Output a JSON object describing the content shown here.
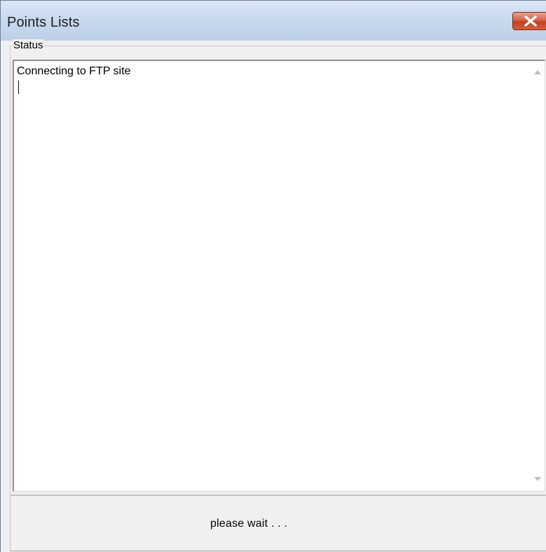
{
  "window": {
    "title": "Points Lists"
  },
  "status_group": {
    "label": "Status",
    "text": "Connecting to FTP site"
  },
  "wait_panel": {
    "text": "please wait . . ."
  },
  "icons": {
    "close": "close-icon",
    "scroll_up": "scroll-up-arrow-icon",
    "scroll_down": "scroll-down-arrow-icon"
  },
  "colors": {
    "close_button": "#c2401f",
    "titlebar": "#c9daee",
    "panel": "#f0f0f0"
  }
}
